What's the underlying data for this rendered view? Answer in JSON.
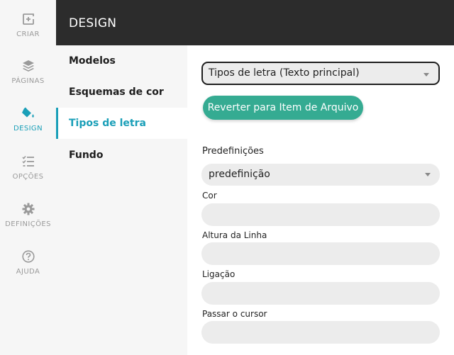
{
  "rail": {
    "items": [
      {
        "label": "CRIAR",
        "icon": "create-icon"
      },
      {
        "label": "PÁGINAS",
        "icon": "layers-icon"
      },
      {
        "label": "DESIGN",
        "icon": "paint-bucket-icon"
      },
      {
        "label": "OPÇÕES",
        "icon": "checklist-icon"
      },
      {
        "label": "DEFINIÇÕES",
        "icon": "gear-icon"
      },
      {
        "label": "AJUDA",
        "icon": "help-icon"
      }
    ],
    "active": "DESIGN"
  },
  "header": {
    "title": "DESIGN"
  },
  "subnav": {
    "items": [
      {
        "label": "Modelos"
      },
      {
        "label": "Esquemas de cor"
      },
      {
        "label": "Tipos de letra"
      },
      {
        "label": "Fundo"
      }
    ],
    "active": "Tipos de letra"
  },
  "panel": {
    "font_target_select": "Tipos de letra (Texto principal)",
    "revert_button": "Reverter para Item de Arquivo",
    "presets_label": "Predefinições",
    "preset_select": "predefinição",
    "fields": [
      {
        "label": "Cor",
        "value": ""
      },
      {
        "label": "Altura da Linha",
        "value": ""
      },
      {
        "label": "Ligação",
        "value": ""
      },
      {
        "label": "Passar o cursor",
        "value": ""
      }
    ]
  },
  "colors": {
    "accent": "#1a9fb8",
    "button": "#35ab92",
    "header_bg": "#2c2c2c"
  }
}
